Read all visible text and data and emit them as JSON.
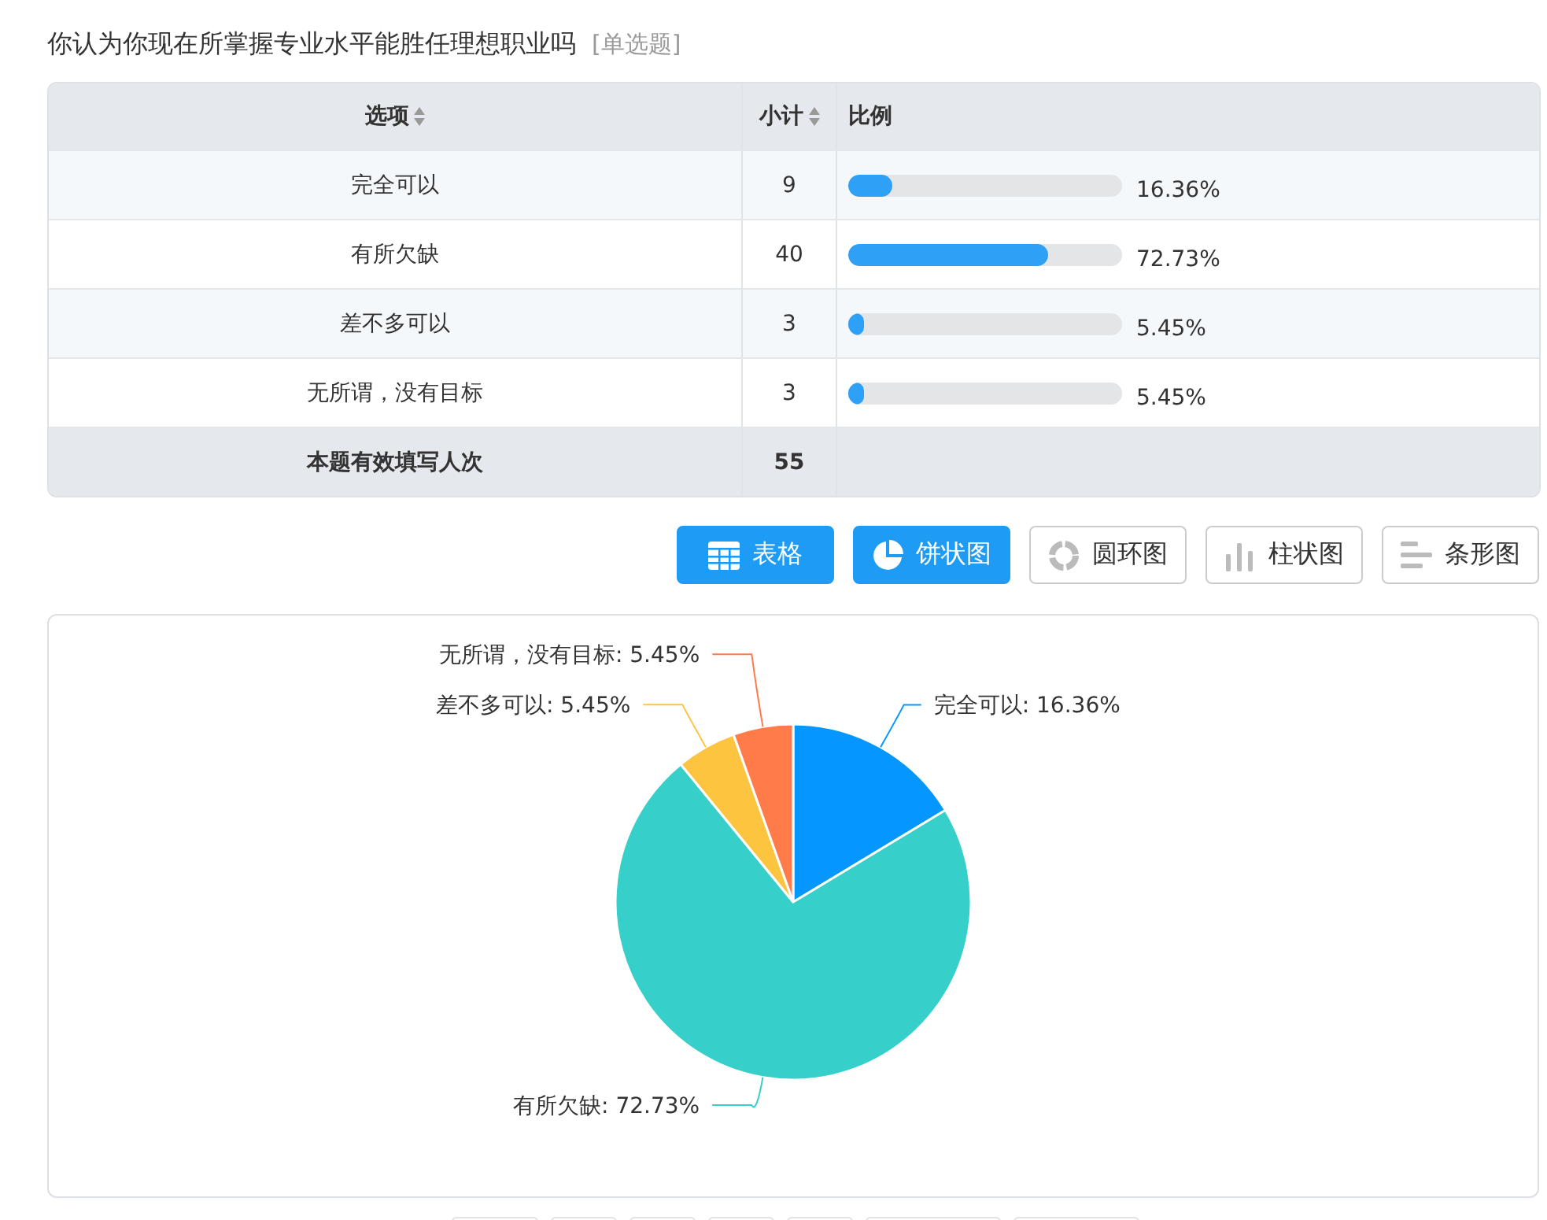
{
  "question": {
    "title": "你认为你现在所掌握专业水平能胜任理想职业吗",
    "type": "[单选题]"
  },
  "table": {
    "columns": [
      {
        "label": "选项",
        "sortable": true
      },
      {
        "label": "小计",
        "sortable": true
      },
      {
        "label": "比例",
        "sortable": false
      }
    ],
    "rows": [
      {
        "option": "完全可以",
        "count": "9",
        "level": 0.1636,
        "percent": "16.36%"
      },
      {
        "option": "有所欠缺",
        "count": "40",
        "level": 0.7273,
        "percent": "72.73%"
      },
      {
        "option": "差不多可以",
        "count": "3",
        "level": 0.0545,
        "percent": "5.45%"
      },
      {
        "option": "无所谓，没有目标",
        "count": "3",
        "level": 0.0545,
        "percent": "5.45%"
      }
    ],
    "total": {
      "label": "本题有效填写人次",
      "count": "55"
    }
  },
  "view_buttons": [
    {
      "label": "表格",
      "kind": "table",
      "selected": true
    },
    {
      "label": "饼状图",
      "kind": "pie",
      "selected": true
    },
    {
      "label": "圆环图",
      "kind": "donut",
      "selected": false
    },
    {
      "label": "柱状图",
      "kind": "bar",
      "selected": false
    },
    {
      "label": "条形图",
      "kind": "hbar",
      "selected": false
    }
  ],
  "chart_data": {
    "type": "pie",
    "values": [
      16.36,
      72.73,
      5.45,
      5.45
    ],
    "colors": [
      "#0597ff",
      "#36cfc9",
      "#fdc440",
      "#ff7c4a"
    ],
    "value_labels": [
      "完全可以: 16.36%",
      "有所欠缺: 72.73%",
      "差不多可以: 5.45%",
      "无所谓，没有目标: 5.45%"
    ]
  }
}
